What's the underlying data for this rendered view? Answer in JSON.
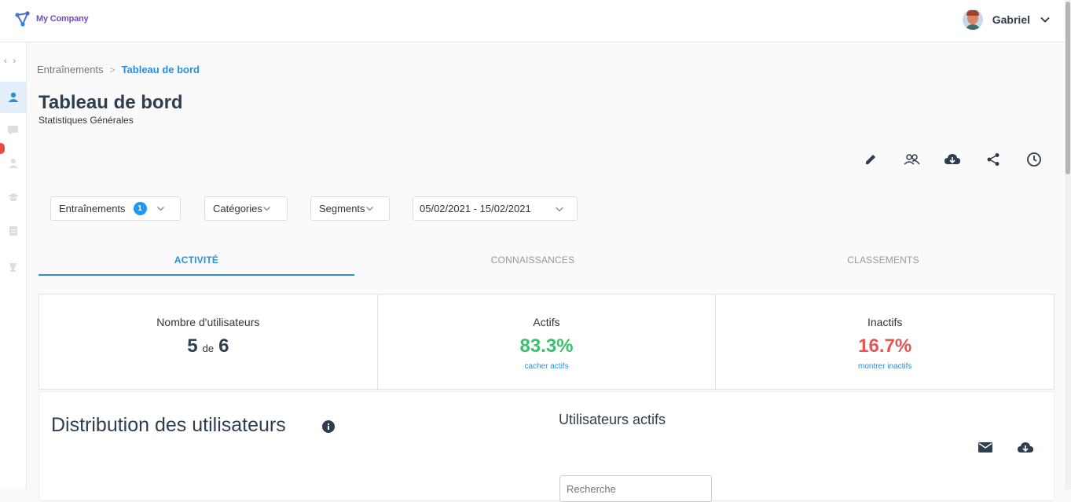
{
  "header": {
    "company": "My Company",
    "user_name": "Gabriel"
  },
  "breadcrumb": {
    "parent": "Entraînements",
    "separator": ">",
    "current": "Tableau de bord"
  },
  "page": {
    "title": "Tableau de bord",
    "subtitle": "Statistiques Générales"
  },
  "actions": [
    "edit-icon",
    "users-icon",
    "cloud-download-icon",
    "share-icon",
    "clock-icon"
  ],
  "filters": {
    "trainings": {
      "label": "Entraînements",
      "count": "1"
    },
    "categories": {
      "label": "Catégories"
    },
    "segments": {
      "label": "Segments"
    },
    "date_range": {
      "value": "05/02/2021 - 15/02/2021"
    }
  },
  "tabs": [
    {
      "label": "ACTIVITÉ",
      "active": true
    },
    {
      "label": "CONNAISSANCES",
      "active": false
    },
    {
      "label": "CLASSEMENTS",
      "active": false
    }
  ],
  "stats": {
    "users": {
      "label": "Nombre d'utilisateurs",
      "value": "5",
      "of": "de",
      "total": "6"
    },
    "active": {
      "label": "Actifs",
      "value": "83.3%",
      "link": "cacher actifs",
      "color": "#3cbf6e"
    },
    "inactive": {
      "label": "Inactifs",
      "value": "16.7%",
      "link": "montrer inactifs",
      "color": "#e55555"
    }
  },
  "distribution": {
    "title": "Distribution des utilisateurs"
  },
  "active_users": {
    "title": "Utilisateurs actifs",
    "search_placeholder": "Recherche"
  },
  "colors": {
    "accent": "#2b8fd9",
    "brand": "#6b4fbf",
    "alert": "#e74c3c"
  }
}
